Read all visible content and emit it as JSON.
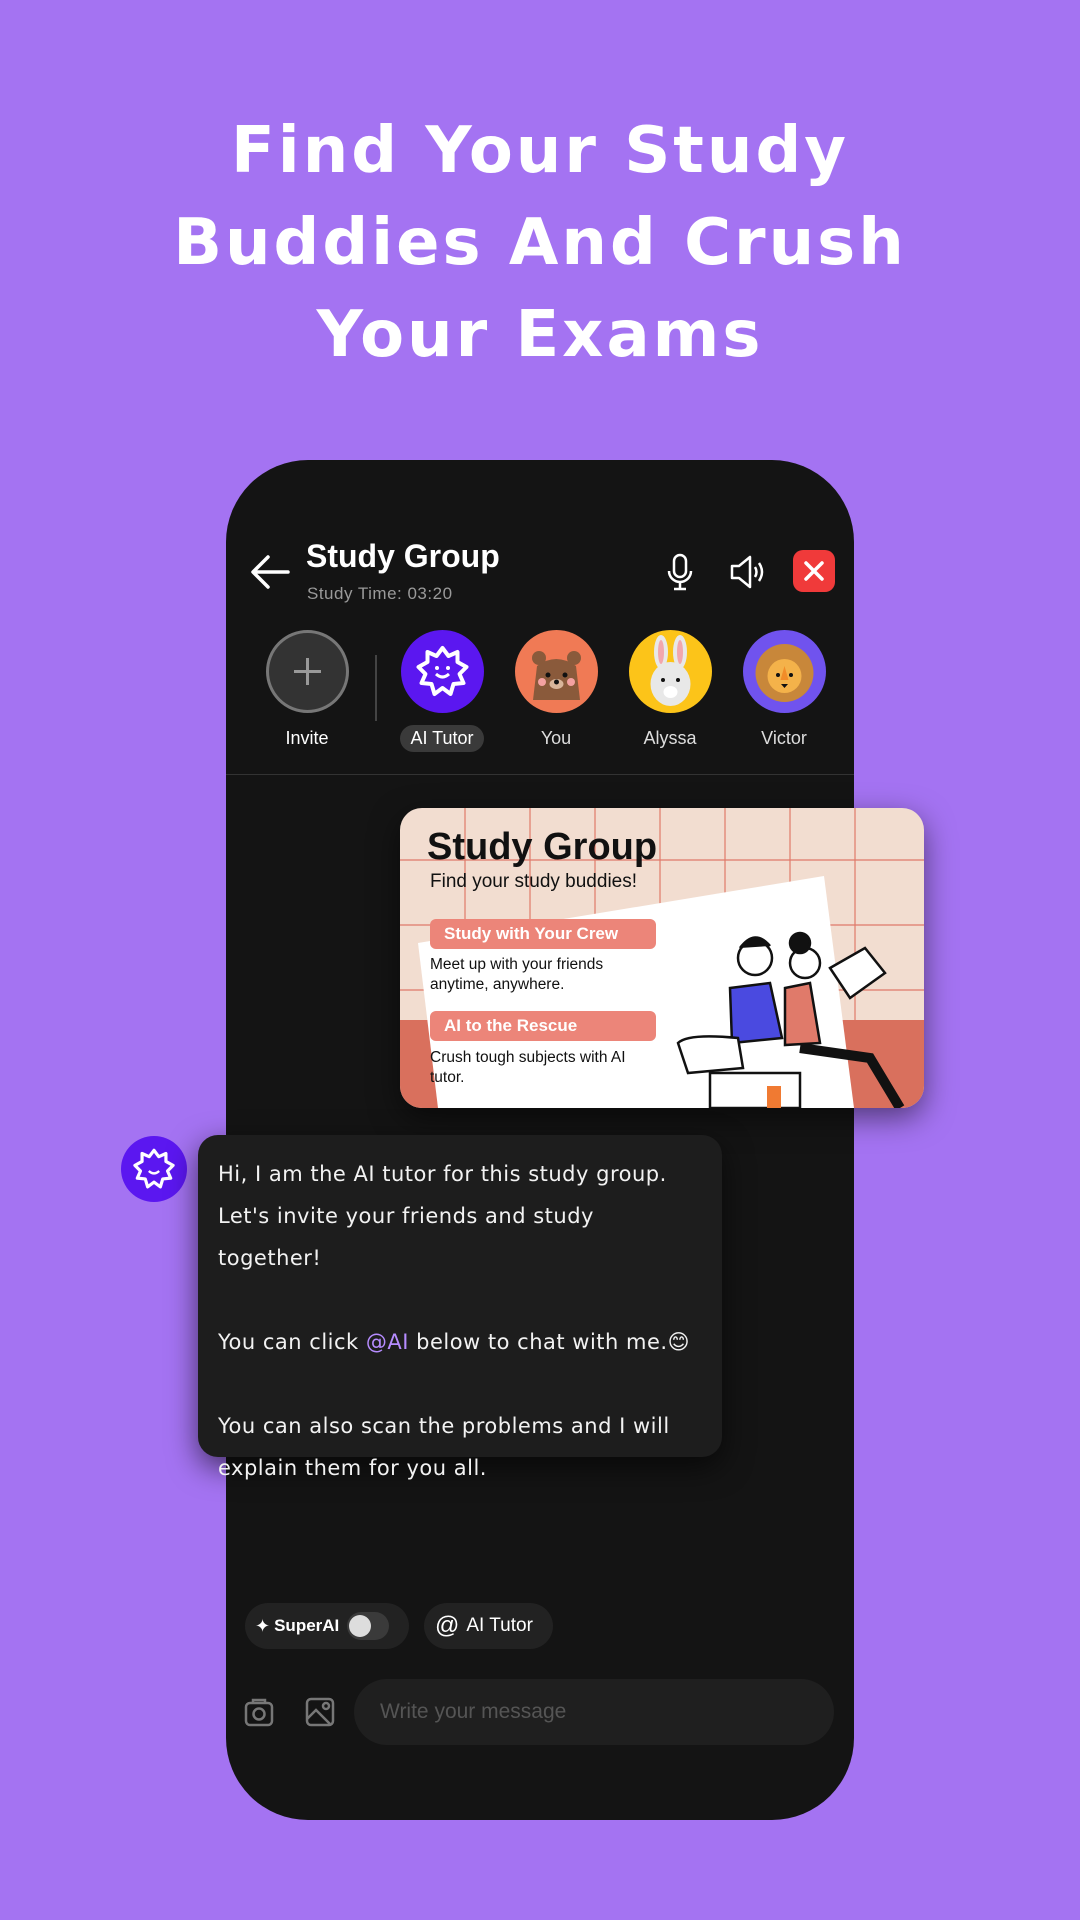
{
  "headline": {
    "line1": "Find Your Study",
    "line2": "Buddies And Crush",
    "line3": "Your Exams"
  },
  "header": {
    "title": "Study Group",
    "subtitle": "Study Time: 03:20"
  },
  "members": [
    {
      "label": "Invite",
      "icon": "plus-icon"
    },
    {
      "label": "AI Tutor",
      "icon": "ai-star-icon",
      "color": "#5b17f0",
      "selected": true
    },
    {
      "label": "You",
      "icon": "bear-icon",
      "color": "#f07a55"
    },
    {
      "label": "Alyssa",
      "icon": "bunny-icon",
      "color": "#fcc419"
    },
    {
      "label": "Victor",
      "icon": "lion-icon",
      "color": "#7053ee"
    }
  ],
  "card": {
    "title": "Study Group",
    "subtitle": "Find your study buddies!",
    "f1_title": "Study with Your Crew",
    "f1_text": "Meet up with your friends anytime, anywhere.",
    "f2_title": "AI to the Rescue",
    "f2_text": "Crush tough subjects with AI tutor."
  },
  "message": {
    "l1": "Hi, I am the AI tutor for this study group.",
    "l2": "Let's invite your friends and study together!",
    "l3a": "You can click ",
    "l3b": "@AI",
    "l3c": " below to chat with me.😊",
    "l4": "You can also scan the problems and I will",
    "l5": "explain them for you all."
  },
  "chips": {
    "superai": "SuperAI",
    "superai_on": false,
    "aitutor": "AI Tutor"
  },
  "composer": {
    "placeholder": "Write your message",
    "value": ""
  },
  "colors": {
    "background": "#a473f2",
    "accent": "#5b17f0",
    "close": "#f03a3a",
    "mention": "#b68cff"
  }
}
